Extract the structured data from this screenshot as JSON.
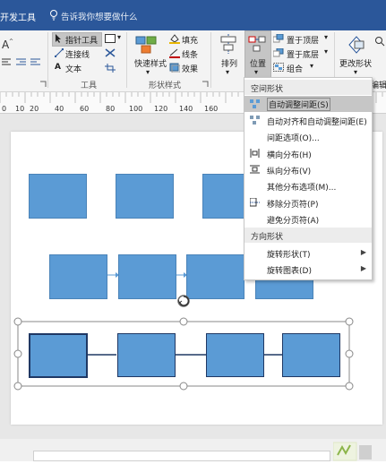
{
  "title_bar": {
    "tab": "开发工具",
    "tell_me": "告诉我你想要做什么"
  },
  "ribbon": {
    "tools": {
      "pointer": "指针工具",
      "connector": "连接线",
      "text": "文本",
      "group_label": "工具"
    },
    "shape_styles": {
      "quick_styles": "快速样式",
      "fill": "填充",
      "line": "线条",
      "effects": "效果",
      "group_label": "形状样式"
    },
    "arrange": {
      "align": "排列",
      "position": "位置",
      "bring_front": "置于顶层",
      "send_back": "置于底层",
      "group": "组合"
    },
    "change_shape": "更改形状",
    "edit": "编辑"
  },
  "ruler": {
    "ticks": [
      "0",
      "10",
      "20",
      "40",
      "60",
      "80",
      "100",
      "120",
      "140",
      "160"
    ]
  },
  "menu": {
    "sections": {
      "spacing": "空间形状",
      "orientation": "方向形状"
    },
    "items": [
      {
        "label": "自动调整间距(S)",
        "icon": "auto-space-icon"
      },
      {
        "label": "自动对齐和自动调整间距(E)",
        "icon": "align-space-icon"
      },
      {
        "label": "间距选项(O)..."
      },
      {
        "label": "横向分布(H)",
        "icon": "distribute-h-icon"
      },
      {
        "label": "纵向分布(V)",
        "icon": "distribute-v-icon"
      },
      {
        "label": "其他分布选项(M)..."
      },
      {
        "label": "移除分页符(P)",
        "icon": "page-break-icon"
      },
      {
        "label": "避免分页符(A)"
      },
      {
        "label": "旋转形状(T)",
        "submenu": true
      },
      {
        "label": "旋转图表(D)",
        "submenu": true
      }
    ]
  },
  "colors": {
    "shape_fill": "#5b9bd5",
    "shape_border": "#4a83b8",
    "title_bar": "#2b579a",
    "selected_border": "#1f3864"
  }
}
